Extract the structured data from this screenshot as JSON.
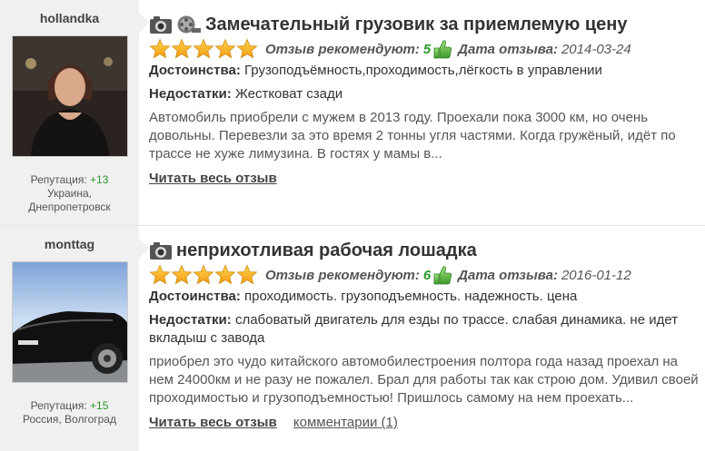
{
  "reviews": [
    {
      "username": "hollandka",
      "reputation_label": "Репутация:",
      "reputation_value": "+13",
      "location_line1": "Украина,",
      "location_line2": "Днепропетровск",
      "title": "Замечательный грузовик за приемлемую цену",
      "icons": [
        "camera-icon",
        "film-reel-icon"
      ],
      "rating": 5,
      "recommend_label": "Отзыв рекомендуют:",
      "recommend_count": "5",
      "date_label": "Дата отзыва:",
      "date": "2014-03-24",
      "pros_label": "Достоинства:",
      "pros": "Грузоподъёмность,проходимость,лёгкость в управлении",
      "cons_label": "Недостатки:",
      "cons": "Жестковат сзади",
      "text": "Автомобиль приобрели с мужем в 2013 году. Проехали пока 3000 км, но очень довольны. Перевезли за это время 2 тонны угля частями. Когда гружёный, идёт по трассе не хуже лимузина. В гостях у мамы в...",
      "read_all": "Читать весь отзыв",
      "comments": ""
    },
    {
      "username": "monttag",
      "reputation_label": "Репутация:",
      "reputation_value": "+15",
      "location_line1": "Россия, Волгоград",
      "location_line2": "",
      "title": "неприхотливая рабочая лошадка",
      "icons": [
        "camera-icon"
      ],
      "rating": 5,
      "recommend_label": "Отзыв рекомендуют:",
      "recommend_count": "6",
      "date_label": "Дата отзыва:",
      "date": "2016-01-12",
      "pros_label": "Достоинства:",
      "pros": "проходимость. грузоподъемность. надежность. цена",
      "cons_label": "Недостатки:",
      "cons": "слабоватый двигатель для езды по трассе. слабая динамика. не идет вкладыш с завода",
      "text": "приобрел это чудо китайского автомобилестроения полтора года назад проехал на нем 24000км и не разу не пожалел. Брал для работы так как строю дом. Удивил своей проходимостью и грузоподъемностью! Пришлось самому на нем проехать...",
      "read_all": "Читать весь отзыв",
      "comments": "комментарии (1)"
    }
  ],
  "colors": {
    "sidebar_bg": "#f0f0f0",
    "star": "#f5a623",
    "positive": "#2a9a2a"
  }
}
